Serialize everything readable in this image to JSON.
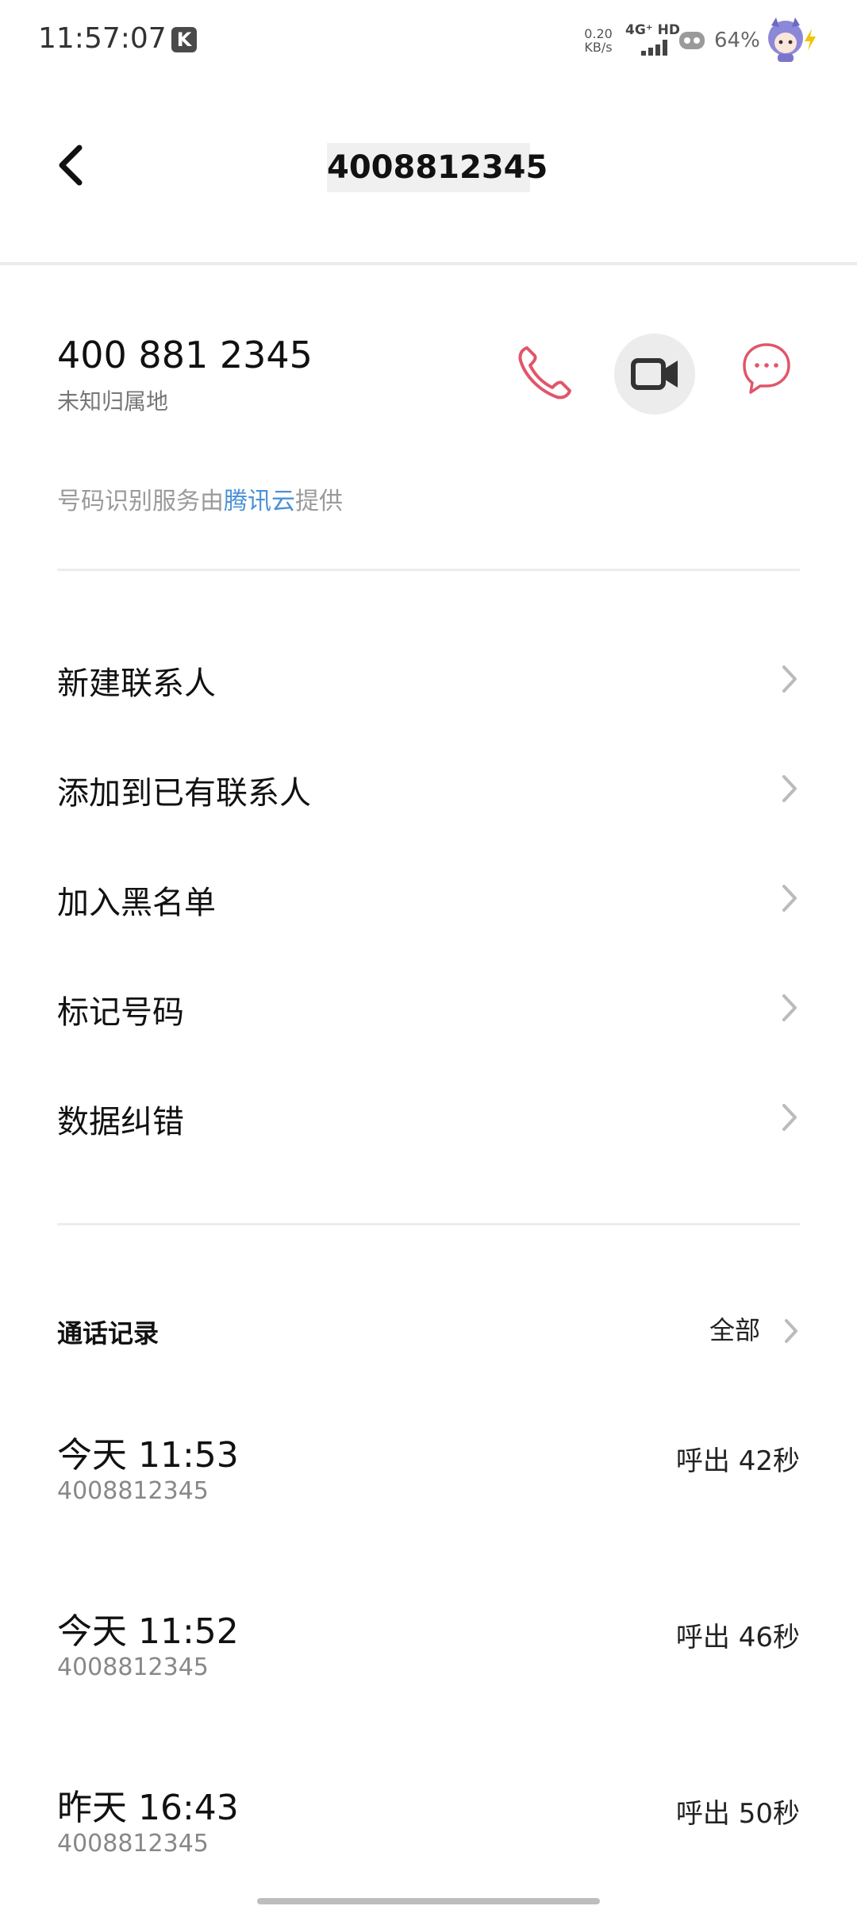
{
  "status_bar": {
    "time": "11:57:07",
    "badge": "K",
    "net_speed_value": "0.20",
    "net_speed_unit": "KB/s",
    "network": "4G⁺ HD",
    "battery": "64%"
  },
  "header": {
    "title": "4008812345"
  },
  "number_card": {
    "number": "400 881 2345",
    "location": "未知归属地",
    "provider_prefix": "号码识别服务由",
    "provider_brand": "腾讯云",
    "provider_suffix": "提供"
  },
  "actions": [
    {
      "label": "新建联系人"
    },
    {
      "label": "添加到已有联系人"
    },
    {
      "label": "加入黑名单"
    },
    {
      "label": "标记号码"
    },
    {
      "label": "数据纠错"
    }
  ],
  "call_log": {
    "title": "通话记录",
    "all_label": "全部",
    "entries": [
      {
        "when": "今天 11:53",
        "number": "4008812345",
        "direction": "呼出 42秒"
      },
      {
        "when": "今天 11:52",
        "number": "4008812345",
        "direction": "呼出 46秒"
      },
      {
        "when": "昨天 16:43",
        "number": "4008812345",
        "direction": "呼出 50秒"
      }
    ]
  },
  "colors": {
    "accent_red": "#e0566b",
    "brand_blue": "#4a90d9",
    "icon_dark": "#333333"
  },
  "icons": [
    "back-arrow-icon",
    "phone-icon",
    "video-camera-icon",
    "message-bubble-icon",
    "chevron-right-icon"
  ]
}
